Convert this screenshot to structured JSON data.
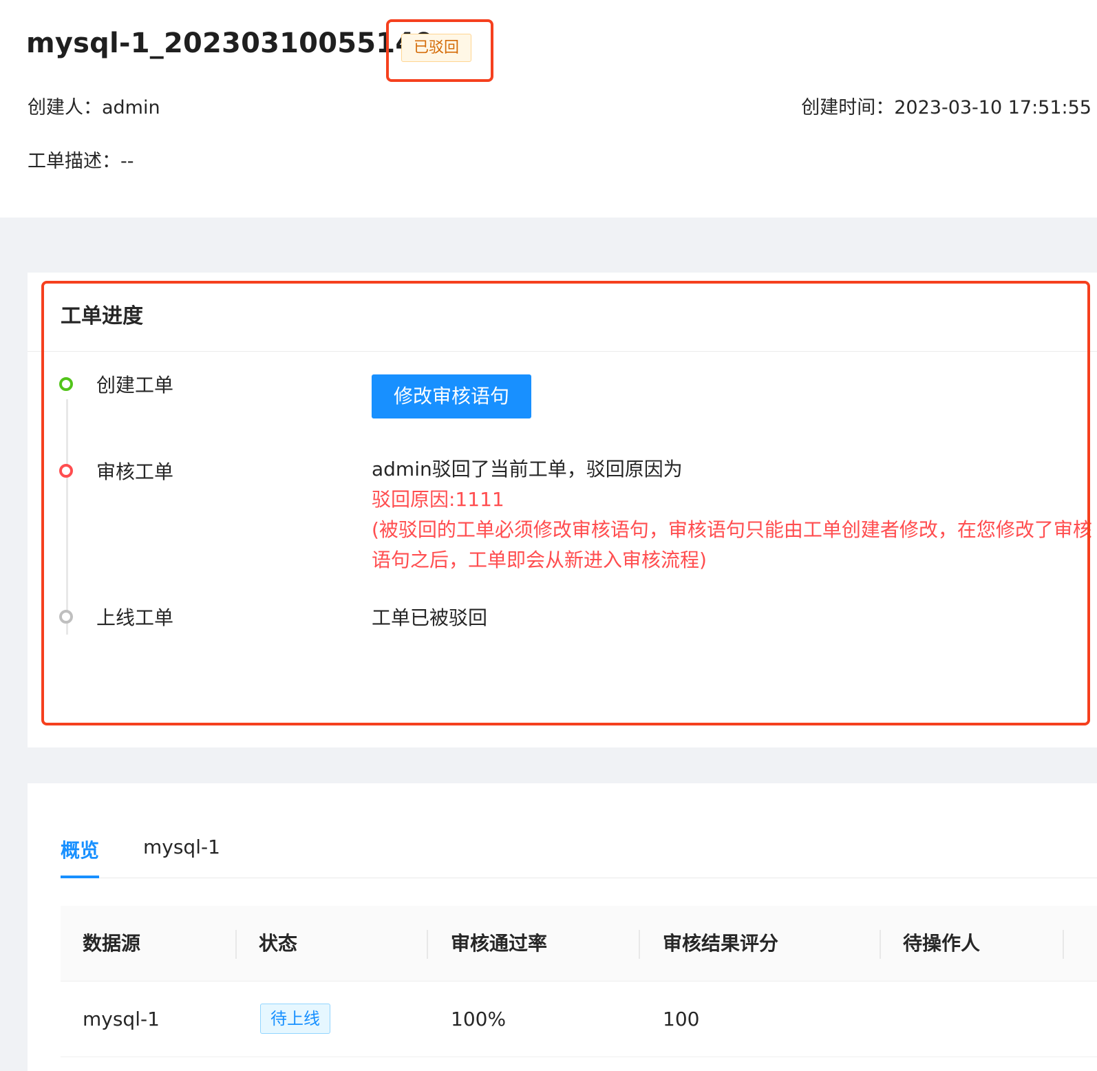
{
  "header": {
    "title": "mysql-1_20230310055149",
    "status": "已驳回",
    "creator": "创建人：admin",
    "created_time": "创建时间：2023-03-10 17:51:55",
    "description": "工单描述：--"
  },
  "progress": {
    "title": "工单进度",
    "steps": [
      {
        "label": "创建工单",
        "action_label": "修改审核语句"
      },
      {
        "label": "审核工单",
        "line1": "admin驳回了当前工单，驳回原因为",
        "line2": "驳回原因:1111",
        "line3": "(被驳回的工单必须修改审核语句，审核语句只能由工单创建者修改，在您修改了审核",
        "line4": "语句之后，工单即会从新进入审核流程)"
      },
      {
        "label": "上线工单",
        "text": "工单已被驳回"
      }
    ],
    "colors": {
      "done": "#52c41a",
      "rejected": "#ff4d4f",
      "pending": "#bfbfbf"
    }
  },
  "tabs": [
    "概览",
    "mysql-1"
  ],
  "table": {
    "columns": [
      "数据源",
      "状态",
      "审核通过率",
      "审核结果评分",
      "待操作人"
    ],
    "rows": [
      {
        "datasource": "mysql-1",
        "status": "待上线",
        "pass_rate": "100%",
        "score": "100",
        "operator": ""
      }
    ]
  },
  "accent_colors": {
    "primary": "#1890ff",
    "highlight": "#f5401e",
    "warning": "#d46b08"
  }
}
